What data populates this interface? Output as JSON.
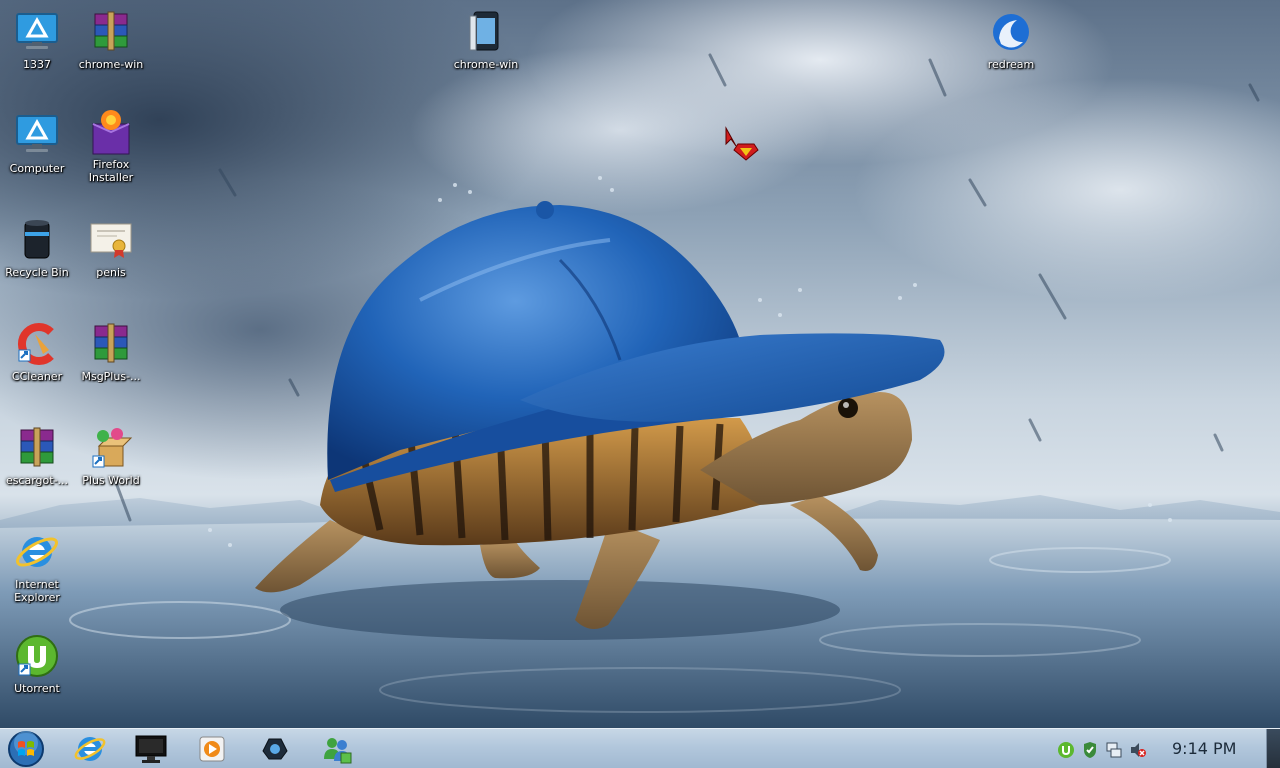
{
  "desktop": {
    "icons": [
      {
        "name": "1337",
        "icon": "computer-monitor-icon"
      },
      {
        "name": "chrome-win",
        "icon": "winrar-archive-icon"
      },
      {
        "name": "chrome-win",
        "icon": "phone-book-icon"
      },
      {
        "name": "redream",
        "icon": "redream-swirl-icon"
      },
      {
        "name": "Computer",
        "icon": "computer-monitor-icon"
      },
      {
        "name": "Firefox Installer",
        "icon": "firefox-installer-icon"
      },
      {
        "name": "Recycle Bin",
        "icon": "recycle-bin-icon"
      },
      {
        "name": "penis",
        "icon": "certificate-icon"
      },
      {
        "name": "CCleaner",
        "icon": "ccleaner-icon"
      },
      {
        "name": "MsgPlus-...",
        "icon": "winrar-archive-icon"
      },
      {
        "name": "escargot-...",
        "icon": "winrar-archive-icon"
      },
      {
        "name": "Plus World",
        "icon": "plus-world-icon"
      },
      {
        "name": "Internet Explorer",
        "icon": "internet-explorer-icon"
      },
      {
        "name": "Utorrent",
        "icon": "utorrent-icon"
      }
    ],
    "wallpaper": "turtle-in-blue-cap-rain"
  },
  "taskbar": {
    "start_icon": "windows-start-orb-icon",
    "apps": [
      {
        "name": "Internet Explorer",
        "icon": "internet-explorer-icon"
      },
      {
        "name": "Command Prompt",
        "icon": "cmd-monitor-icon"
      },
      {
        "name": "Media Player",
        "icon": "media-player-icon"
      },
      {
        "name": "Steam",
        "icon": "steam-icon"
      },
      {
        "name": "Messenger",
        "icon": "messenger-icon"
      }
    ],
    "tray": [
      "utorrent-tray-icon",
      "security-check-icon",
      "network-icon",
      "volume-muted-icon"
    ],
    "clock": "9:14 PM"
  },
  "colors": {
    "taskbar": "#b2c7dc",
    "cap_blue": "#1f5db0",
    "label_text": "#ffffff"
  }
}
